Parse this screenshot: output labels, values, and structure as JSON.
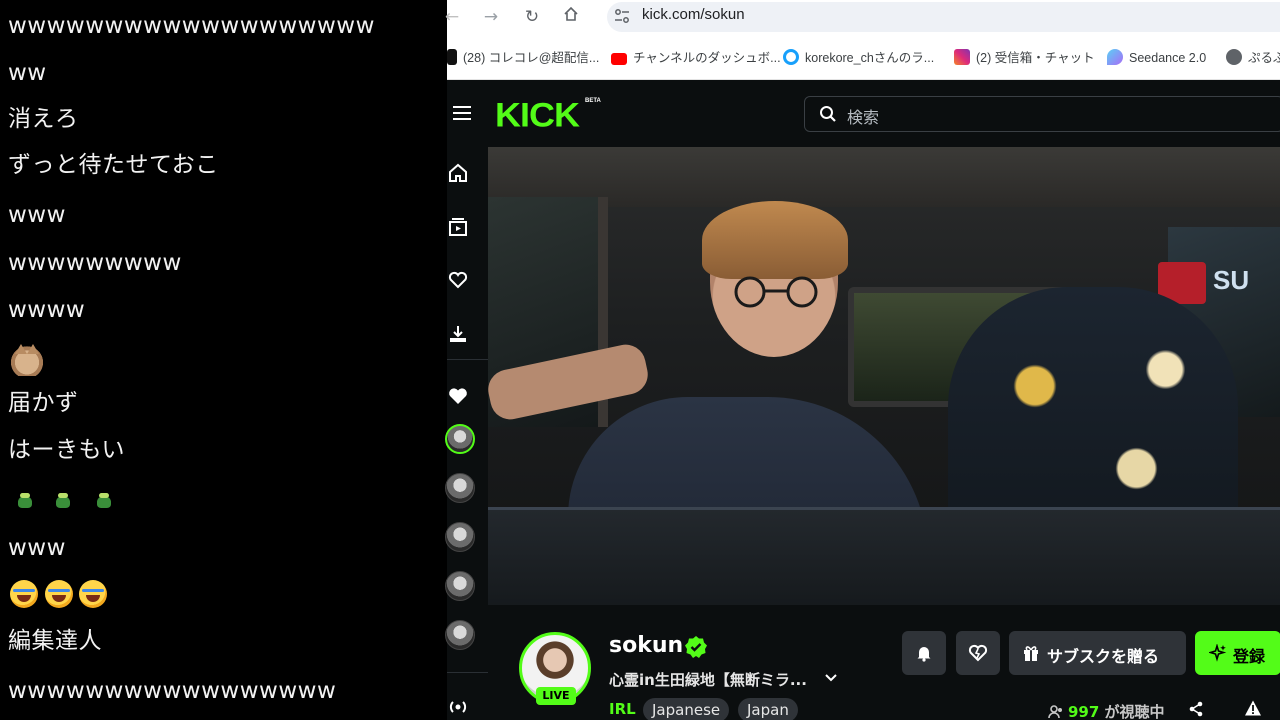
{
  "chat": {
    "messages": [
      "wwwwwwwwwwwwwwwwwww",
      "ww",
      "消えろ",
      "ずっと待たせておこ",
      "www",
      "wwwwwwwww",
      "wwww",
      "届かず",
      "はーきもい",
      "www",
      "編集達人",
      "wwwwwwwwwwwwwwwww"
    ]
  },
  "browser": {
    "url": "kick.com/sokun",
    "bookmarks": [
      {
        "label": "(28) コレコレ@超配信...",
        "color": "#111111"
      },
      {
        "label": "チャンネルのダッシュボ...",
        "color": "#ff0000"
      },
      {
        "label": "korekore_chさんのラ...",
        "color": "#18a0fb"
      },
      {
        "label": "(2) 受信箱・チャット",
        "color": "#d62976"
      },
      {
        "label": "Seedance 2.0",
        "color": "#7b6cf6"
      },
      {
        "label": "ぷるぷ",
        "color": "#5f6368"
      }
    ]
  },
  "kick": {
    "logo": "KICK",
    "beta": "BETA",
    "search_placeholder": "検索",
    "accent": "#53fc18",
    "channel": {
      "name": "sokun",
      "live_label": "LIVE",
      "title": "心霊in生田緑地【無断ミラ...",
      "category": "IRL",
      "tags": [
        "Japanese",
        "Japan"
      ],
      "viewer_count": "997",
      "viewer_suffix": "が視聴中"
    },
    "buttons": {
      "gift_sub": "サブスクを贈る",
      "follow": "登録"
    }
  }
}
